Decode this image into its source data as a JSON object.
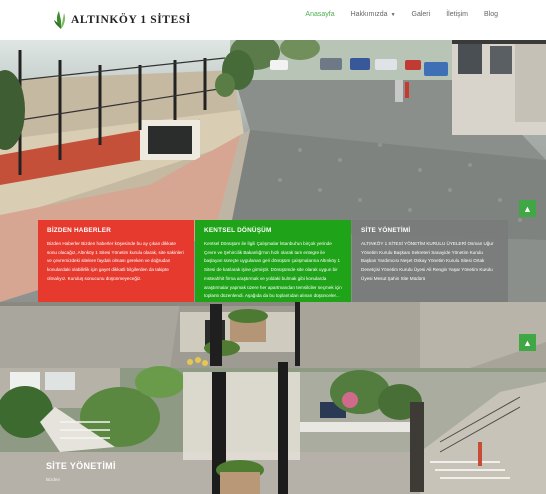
{
  "brand": {
    "name": "ALTINKÖY 1 SİTESİ"
  },
  "nav": {
    "items": [
      {
        "label": "Anasayfa",
        "active": true
      },
      {
        "label": "Hakkımızda",
        "dropdown": true
      },
      {
        "label": "Galeri"
      },
      {
        "label": "İletişim"
      },
      {
        "label": "Blog"
      }
    ]
  },
  "panels": {
    "news": {
      "title": "BİZDEN HABERLER",
      "text": "Bizden Haberler Bizden haberler köşesinde bu ay çıkan dikkate sonu olacağız, Altınköy 1 Sitesi Yönetim kurulu olarak, site sakinleri ve çevremizdeki sitelere faydalı olması gereken ve doğrudan konulardaki olabilirlik için gayet dikkatli bilgilerden da takipte olmalıyız. Kuruluş sonucunu düşünmeyeceğiz."
    },
    "renewal": {
      "title": "KENTSEL DÖNÜŞÜM",
      "text": "Kentsel Dönüşüm ile İlgili Çalışmalar İstanbul'un birçok yerinde Çevre ve Şehircilik Bakanlığı'nın hızlı olarak tam entegre ile başlayan süreçte uygulanan geri dönüşüm çalışmalarına Altınköy 1 Sitesi de katılarak işine girmiştir. Dönüşümde site olarak uygun bir müteahhit firma araştırmak ve yoldaki bulmak gibi konularda araştırmalar yapmak üzere her apartmandan temsilciler seçmek için toplantı düzenlendi. Aşağıda da bu toplantıdan alınan düşünceler..."
    },
    "management": {
      "title": "SİTE YÖNETİMİ",
      "text": "ALTINKÖY 1 SİTESİ YÖNETİM KURULU ÜYELERİ Osman Uğur Yönetim Kurulu Başkanı Sekreteri Sanayide Yönetim Kurulu Başkan Yardımcısı Neşet Oskay Yönetim Kurulu Sitesi Ortak Denetçisi Yönetim Kurulu Üyesi Ali Rengin Yaşar Yönetim Kurulu Üyesi Mesut Şahin Site Müdürü"
    }
  },
  "lower": {
    "title": "SİTE YÖNETİMİ",
    "subtitle": "Bizden"
  },
  "buttons": {
    "scroll_up_icon": "▲"
  },
  "colors": {
    "accent_green": "#4caf50",
    "panel_red": "#e63a2f",
    "panel_green": "#1fa318",
    "panel_gray": "#787c79"
  }
}
